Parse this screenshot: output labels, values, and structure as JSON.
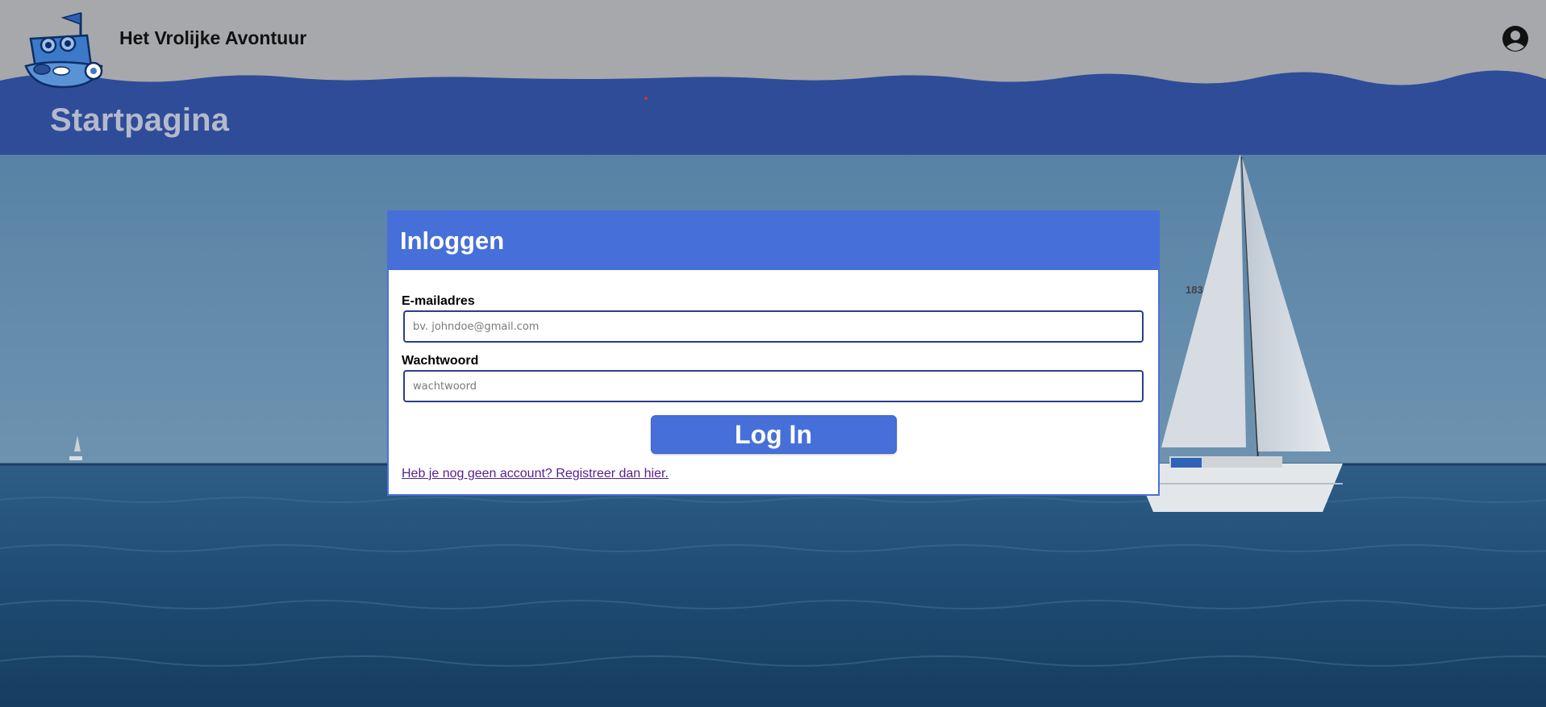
{
  "header": {
    "site_title": "Het Vrolijke Avontuur",
    "page_heading": "Startpagina",
    "logo_icon": "boat-logo-icon",
    "account_icon": "account-circle-icon"
  },
  "login": {
    "title": "Inloggen",
    "email_label": "E-mailadres",
    "email_placeholder": "bv. johndoe@gmail.com",
    "email_value": "",
    "password_label": "Wachtwoord",
    "password_placeholder": "wachtwoord",
    "password_value": "",
    "submit_label": "Log In",
    "register_link": "Heb je nog geen account? Registreer dan hier."
  },
  "background": {
    "sailboat_number": "183"
  },
  "colors": {
    "header_gray": "#a6a8ab",
    "wave_blue": "#2f4c99",
    "accent_blue": "#466fd9",
    "heading_text": "#b4bacb"
  }
}
